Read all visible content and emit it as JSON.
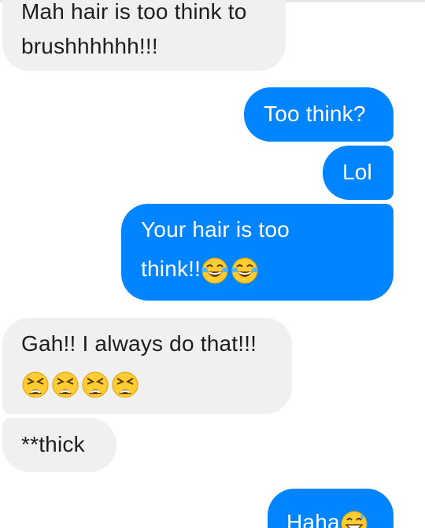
{
  "colors": {
    "incoming_bubble": "#f0f0f0",
    "outgoing_bubble": "#0084ff",
    "incoming_text": "#1e1e1e",
    "outgoing_text": "#ffffff"
  },
  "messages": [
    {
      "direction": "incoming",
      "lines": [
        "Mah hair is too think to",
        "brushhhhhh!!!"
      ]
    },
    {
      "direction": "outgoing",
      "text": "Too think?"
    },
    {
      "direction": "outgoing",
      "text": "Lol"
    },
    {
      "direction": "outgoing",
      "lines": [
        "Your hair is too",
        "think!!"
      ],
      "emojis": [
        "face-with-tears-of-joy",
        "face-with-tears-of-joy"
      ]
    },
    {
      "direction": "incoming",
      "text": "Gah!! I always do that!!!",
      "emojis": [
        "tired-face",
        "tired-face",
        "tired-face",
        "tired-face"
      ]
    },
    {
      "direction": "incoming",
      "text": "**thick"
    },
    {
      "direction": "outgoing",
      "text": "Haha",
      "emojis": [
        "grinning-face-with-sweat"
      ]
    }
  ]
}
